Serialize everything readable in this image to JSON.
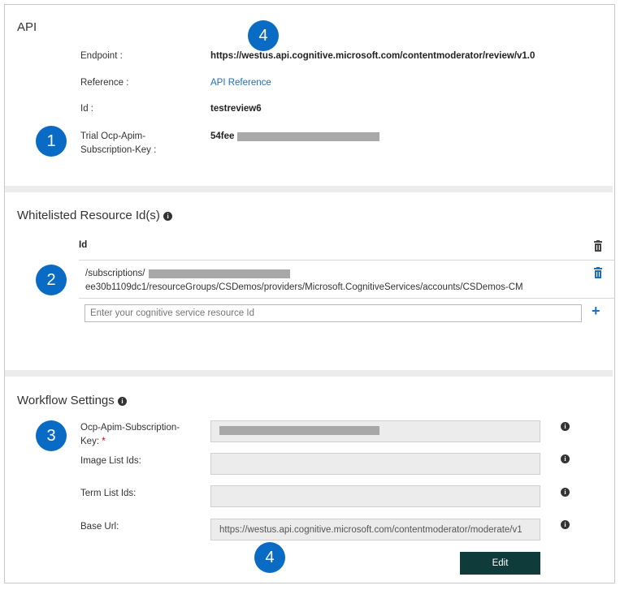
{
  "api": {
    "title": "API",
    "endpoint_label": "Endpoint :",
    "endpoint_value": "https://westus.api.cognitive.microsoft.com/contentmoderator/review/v1.0",
    "reference_label": "Reference :",
    "reference_link": "API Reference",
    "id_label": "Id :",
    "id_value": "testreview6",
    "key_label_line1": "Trial Ocp-Apim-",
    "key_label_line2": "Subscription-Key :",
    "key_value_prefix": "54fee"
  },
  "whitelist": {
    "title": "Whitelisted Resource Id(s)",
    "column_header": "Id",
    "row_line1": "/subscriptions/",
    "row_line2": "ee30b1109dc1/resourceGroups/CSDemos/providers/Microsoft.CognitiveServices/accounts/CSDemos-CM",
    "input_placeholder": "Enter your cognitive service resource Id",
    "add_symbol": "+"
  },
  "workflow": {
    "title": "Workflow Settings",
    "key_label_line1": "Ocp-Apim-Subscription-",
    "key_label_line2": "Key:",
    "required_mark": "*",
    "image_list_label": "Image List Ids:",
    "term_list_label": "Term List Ids:",
    "base_url_label": "Base Url:",
    "base_url_value": "https://westus.api.cognitive.microsoft.com/contentmoderator/moderate/v1",
    "edit_button": "Edit"
  },
  "callouts": {
    "c1": "1",
    "c2": "2",
    "c3": "3",
    "c4_top": "4",
    "c4_bottom": "4"
  },
  "icons": {
    "info": "info-circle-icon",
    "trash": "trash-icon",
    "plus": "plus-icon"
  },
  "colors": {
    "accent": "#0a6bc4",
    "link": "#1a6fc0",
    "button": "#0f3c3a",
    "redacted": "#a8a8a8"
  }
}
